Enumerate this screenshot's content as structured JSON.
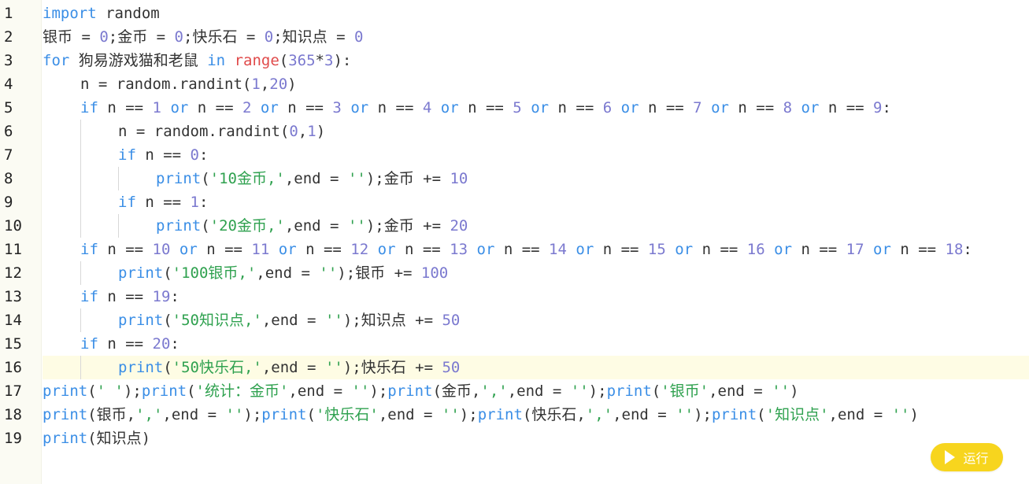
{
  "editor": {
    "line_numbers": [
      "1",
      "2",
      "3",
      "4",
      "5",
      "6",
      "7",
      "8",
      "9",
      "10",
      "11",
      "12",
      "13",
      "14",
      "15",
      "16",
      "17",
      "18",
      "19"
    ],
    "active_line": 16,
    "lines": [
      {
        "indent": 0,
        "tokens": [
          [
            "kw",
            "import"
          ],
          [
            "plain",
            " random"
          ]
        ]
      },
      {
        "indent": 0,
        "tokens": [
          [
            "plain",
            "银币 = "
          ],
          [
            "num",
            "0"
          ],
          [
            "plain",
            ";金币 = "
          ],
          [
            "num",
            "0"
          ],
          [
            "plain",
            ";快乐石 = "
          ],
          [
            "num",
            "0"
          ],
          [
            "plain",
            ";知识点 = "
          ],
          [
            "num",
            "0"
          ]
        ]
      },
      {
        "indent": 0,
        "tokens": [
          [
            "kw",
            "for"
          ],
          [
            "plain",
            " 狗易游戏猫和老鼠 "
          ],
          [
            "kw",
            "in"
          ],
          [
            "plain",
            " "
          ],
          [
            "bi",
            "range"
          ],
          [
            "plain",
            "("
          ],
          [
            "num",
            "365"
          ],
          [
            "plain",
            "*"
          ],
          [
            "num",
            "3"
          ],
          [
            "plain",
            "):"
          ]
        ]
      },
      {
        "indent": 1,
        "tokens": [
          [
            "plain",
            "n = random.randint("
          ],
          [
            "num",
            "1"
          ],
          [
            "plain",
            ","
          ],
          [
            "num",
            "20"
          ],
          [
            "plain",
            ")"
          ]
        ]
      },
      {
        "indent": 1,
        "tokens": [
          [
            "kw",
            "if"
          ],
          [
            "plain",
            " n == "
          ],
          [
            "num",
            "1"
          ],
          [
            "plain",
            " "
          ],
          [
            "kw",
            "or"
          ],
          [
            "plain",
            " n == "
          ],
          [
            "num",
            "2"
          ],
          [
            "plain",
            " "
          ],
          [
            "kw",
            "or"
          ],
          [
            "plain",
            " n == "
          ],
          [
            "num",
            "3"
          ],
          [
            "plain",
            " "
          ],
          [
            "kw",
            "or"
          ],
          [
            "plain",
            " n == "
          ],
          [
            "num",
            "4"
          ],
          [
            "plain",
            " "
          ],
          [
            "kw",
            "or"
          ],
          [
            "plain",
            " n == "
          ],
          [
            "num",
            "5"
          ],
          [
            "plain",
            " "
          ],
          [
            "kw",
            "or"
          ],
          [
            "plain",
            " n == "
          ],
          [
            "num",
            "6"
          ],
          [
            "plain",
            " "
          ],
          [
            "kw",
            "or"
          ],
          [
            "plain",
            " n == "
          ],
          [
            "num",
            "7"
          ],
          [
            "plain",
            " "
          ],
          [
            "kw",
            "or"
          ],
          [
            "plain",
            " n == "
          ],
          [
            "num",
            "8"
          ],
          [
            "plain",
            " "
          ],
          [
            "kw",
            "or"
          ],
          [
            "plain",
            " n == "
          ],
          [
            "num",
            "9"
          ],
          [
            "plain",
            ":"
          ]
        ]
      },
      {
        "indent": 2,
        "tokens": [
          [
            "plain",
            "n = random.randint("
          ],
          [
            "num",
            "0"
          ],
          [
            "plain",
            ","
          ],
          [
            "num",
            "1"
          ],
          [
            "plain",
            ")"
          ]
        ]
      },
      {
        "indent": 2,
        "tokens": [
          [
            "kw",
            "if"
          ],
          [
            "plain",
            " n == "
          ],
          [
            "num",
            "0"
          ],
          [
            "plain",
            ":"
          ]
        ]
      },
      {
        "indent": 3,
        "tokens": [
          [
            "kw",
            "print"
          ],
          [
            "plain",
            "("
          ],
          [
            "str",
            "'10金币,'"
          ],
          [
            "plain",
            ",end = "
          ],
          [
            "str",
            "''"
          ],
          [
            "plain",
            ");金币 += "
          ],
          [
            "num",
            "10"
          ]
        ]
      },
      {
        "indent": 2,
        "tokens": [
          [
            "kw",
            "if"
          ],
          [
            "plain",
            " n == "
          ],
          [
            "num",
            "1"
          ],
          [
            "plain",
            ":"
          ]
        ]
      },
      {
        "indent": 3,
        "tokens": [
          [
            "kw",
            "print"
          ],
          [
            "plain",
            "("
          ],
          [
            "str",
            "'20金币,'"
          ],
          [
            "plain",
            ",end = "
          ],
          [
            "str",
            "''"
          ],
          [
            "plain",
            ");金币 += "
          ],
          [
            "num",
            "20"
          ]
        ]
      },
      {
        "indent": 1,
        "tokens": [
          [
            "kw",
            "if"
          ],
          [
            "plain",
            " n == "
          ],
          [
            "num",
            "10"
          ],
          [
            "plain",
            " "
          ],
          [
            "kw",
            "or"
          ],
          [
            "plain",
            " n == "
          ],
          [
            "num",
            "11"
          ],
          [
            "plain",
            " "
          ],
          [
            "kw",
            "or"
          ],
          [
            "plain",
            " n == "
          ],
          [
            "num",
            "12"
          ],
          [
            "plain",
            " "
          ],
          [
            "kw",
            "or"
          ],
          [
            "plain",
            " n == "
          ],
          [
            "num",
            "13"
          ],
          [
            "plain",
            " "
          ],
          [
            "kw",
            "or"
          ],
          [
            "plain",
            " n == "
          ],
          [
            "num",
            "14"
          ],
          [
            "plain",
            " "
          ],
          [
            "kw",
            "or"
          ],
          [
            "plain",
            " n == "
          ],
          [
            "num",
            "15"
          ],
          [
            "plain",
            " "
          ],
          [
            "kw",
            "or"
          ],
          [
            "plain",
            " n == "
          ],
          [
            "num",
            "16"
          ],
          [
            "plain",
            " "
          ],
          [
            "kw",
            "or"
          ],
          [
            "plain",
            " n == "
          ],
          [
            "num",
            "17"
          ],
          [
            "plain",
            " "
          ],
          [
            "kw",
            "or"
          ],
          [
            "plain",
            " n == "
          ],
          [
            "num",
            "18"
          ],
          [
            "plain",
            ":"
          ]
        ]
      },
      {
        "indent": 2,
        "tokens": [
          [
            "kw",
            "print"
          ],
          [
            "plain",
            "("
          ],
          [
            "str",
            "'100银币,'"
          ],
          [
            "plain",
            ",end = "
          ],
          [
            "str",
            "''"
          ],
          [
            "plain",
            ");银币 += "
          ],
          [
            "num",
            "100"
          ]
        ]
      },
      {
        "indent": 1,
        "tokens": [
          [
            "kw",
            "if"
          ],
          [
            "plain",
            " n == "
          ],
          [
            "num",
            "19"
          ],
          [
            "plain",
            ":"
          ]
        ]
      },
      {
        "indent": 2,
        "tokens": [
          [
            "kw",
            "print"
          ],
          [
            "plain",
            "("
          ],
          [
            "str",
            "'50知识点,'"
          ],
          [
            "plain",
            ",end = "
          ],
          [
            "str",
            "''"
          ],
          [
            "plain",
            ");知识点 += "
          ],
          [
            "num",
            "50"
          ]
        ]
      },
      {
        "indent": 1,
        "tokens": [
          [
            "kw",
            "if"
          ],
          [
            "plain",
            " n == "
          ],
          [
            "num",
            "20"
          ],
          [
            "plain",
            ":"
          ]
        ]
      },
      {
        "indent": 2,
        "tokens": [
          [
            "kw",
            "print"
          ],
          [
            "plain",
            "("
          ],
          [
            "str",
            "'50快乐石,'"
          ],
          [
            "plain",
            ",end = "
          ],
          [
            "str",
            "''"
          ],
          [
            "plain",
            ");快乐石 += "
          ],
          [
            "num",
            "50"
          ]
        ]
      },
      {
        "indent": 0,
        "tokens": [
          [
            "kw",
            "print"
          ],
          [
            "plain",
            "("
          ],
          [
            "str",
            "' '"
          ],
          [
            "plain",
            ");"
          ],
          [
            "kw",
            "print"
          ],
          [
            "plain",
            "("
          ],
          [
            "str",
            "'统计：金币'"
          ],
          [
            "plain",
            ",end = "
          ],
          [
            "str",
            "''"
          ],
          [
            "plain",
            ");"
          ],
          [
            "kw",
            "print"
          ],
          [
            "plain",
            "(金币,"
          ],
          [
            "str",
            "','"
          ],
          [
            "plain",
            ",end = "
          ],
          [
            "str",
            "''"
          ],
          [
            "plain",
            ");"
          ],
          [
            "kw",
            "print"
          ],
          [
            "plain",
            "("
          ],
          [
            "str",
            "'银币'"
          ],
          [
            "plain",
            ",end = "
          ],
          [
            "str",
            "''"
          ],
          [
            "plain",
            ")"
          ]
        ]
      },
      {
        "indent": 0,
        "tokens": [
          [
            "kw",
            "print"
          ],
          [
            "plain",
            "(银币,"
          ],
          [
            "str",
            "','"
          ],
          [
            "plain",
            ",end = "
          ],
          [
            "str",
            "''"
          ],
          [
            "plain",
            ");"
          ],
          [
            "kw",
            "print"
          ],
          [
            "plain",
            "("
          ],
          [
            "str",
            "'快乐石'"
          ],
          [
            "plain",
            ",end = "
          ],
          [
            "str",
            "''"
          ],
          [
            "plain",
            ");"
          ],
          [
            "kw",
            "print"
          ],
          [
            "plain",
            "(快乐石,"
          ],
          [
            "str",
            "','"
          ],
          [
            "plain",
            ",end = "
          ],
          [
            "str",
            "''"
          ],
          [
            "plain",
            ");"
          ],
          [
            "kw",
            "print"
          ],
          [
            "plain",
            "("
          ],
          [
            "str",
            "'知识点'"
          ],
          [
            "plain",
            ",end = "
          ],
          [
            "str",
            "''"
          ],
          [
            "plain",
            ")"
          ]
        ]
      },
      {
        "indent": 0,
        "tokens": [
          [
            "kw",
            "print"
          ],
          [
            "plain",
            "(知识点)"
          ]
        ]
      }
    ]
  },
  "run_button": {
    "label": "运行",
    "color": "#f7d51e"
  },
  "colors": {
    "keyword": "#3a8ee6",
    "number": "#7b79cf",
    "string": "#2fa14f",
    "builtin": "#e04a4a",
    "text": "#333333"
  }
}
